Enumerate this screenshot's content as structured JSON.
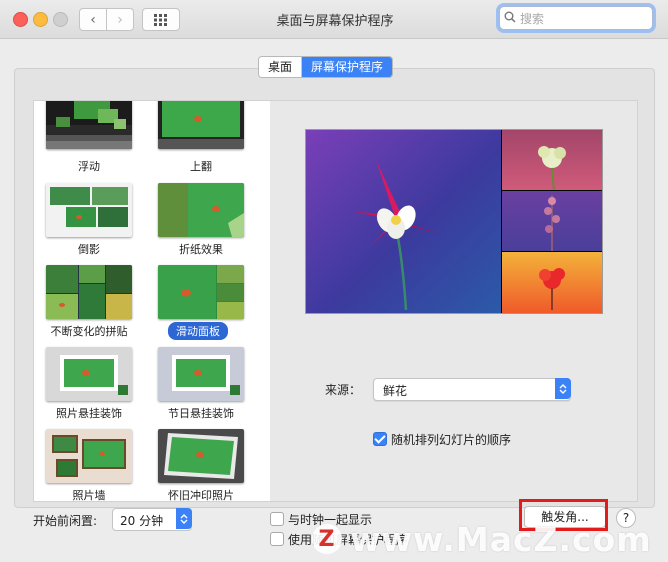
{
  "window": {
    "title": "桌面与屏幕保护程序",
    "search_placeholder": "搜索"
  },
  "tabs": [
    {
      "label": "桌面",
      "active": false
    },
    {
      "label": "屏幕保护程序",
      "active": true
    }
  ],
  "savers": [
    {
      "label": "浮动",
      "selected": false
    },
    {
      "label": "上翻",
      "selected": false
    },
    {
      "label": "倒影",
      "selected": false
    },
    {
      "label": "折纸效果",
      "selected": false
    },
    {
      "label": "不断变化的拼贴",
      "selected": false
    },
    {
      "label": "滑动面板",
      "selected": true
    },
    {
      "label": "照片悬挂装饰",
      "selected": false
    },
    {
      "label": "节日悬挂装饰",
      "selected": false
    },
    {
      "label": "照片墙",
      "selected": false
    },
    {
      "label": "怀旧冲印照片",
      "selected": false
    }
  ],
  "source": {
    "label": "来源：",
    "value": "鲜花"
  },
  "shuffle": {
    "label": "随机排列幻灯片的顺序",
    "checked": true
  },
  "idle": {
    "label": "开始前闲置:",
    "value": "20 分钟"
  },
  "clock": {
    "label": "与时钟一起显示",
    "checked": false
  },
  "random_saver": {
    "label": "使用随机屏幕保护程序",
    "checked": false
  },
  "hot_corners_label": "触发角...",
  "help_label": "?",
  "watermark": {
    "text": "www.MacZ.com",
    "logo": "Z"
  },
  "colors": {
    "accent": "#3b82f7",
    "selection": "#2d67d4",
    "highlight_frame": "#e21b1b"
  }
}
